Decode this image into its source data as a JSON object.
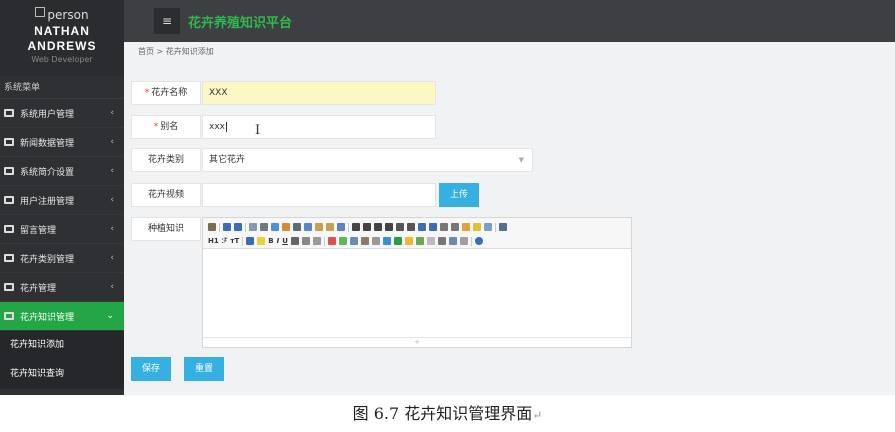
{
  "profile": {
    "image_alt": "person",
    "name_first": "NATHAN",
    "name_last": "ANDREWS",
    "role": "Web Developer"
  },
  "header": {
    "menu_icon": "hamburger-icon",
    "title": "花卉养殖知识平台",
    "title_color": "#2fb84e"
  },
  "breadcrumb": "首页 > 花卉知识添加",
  "sidebar": {
    "section_title": "系统菜单",
    "items": [
      {
        "label": "系统用户管理"
      },
      {
        "label": "新闻数据管理"
      },
      {
        "label": "系统简介设置"
      },
      {
        "label": "用户注册管理"
      },
      {
        "label": "留言管理"
      },
      {
        "label": "花卉类别管理"
      },
      {
        "label": "花卉管理"
      },
      {
        "label": "花卉知识管理"
      }
    ],
    "active_color": "#23a645",
    "sub_items": [
      {
        "label": "花卉知识添加"
      },
      {
        "label": "花卉知识查询"
      }
    ]
  },
  "form": {
    "name_label": "花卉名称",
    "name_value": "XXX",
    "alias_label": "别名",
    "alias_value": "xxx",
    "category_label": "花卉类别",
    "category_value": "其它花卉",
    "video_label": "花卉视频",
    "video_value": "",
    "upload_label": "上传",
    "knowledge_label": "种植知识",
    "toolbar_heading_label": "H1",
    "toolbar_font_label": "ℱ",
    "toolbar_size_label": "тT",
    "save_label": "保存",
    "reset_label": "重置"
  },
  "caption": {
    "text": "图 6.7 花卉知识管理界面",
    "return_mark": "↵"
  }
}
